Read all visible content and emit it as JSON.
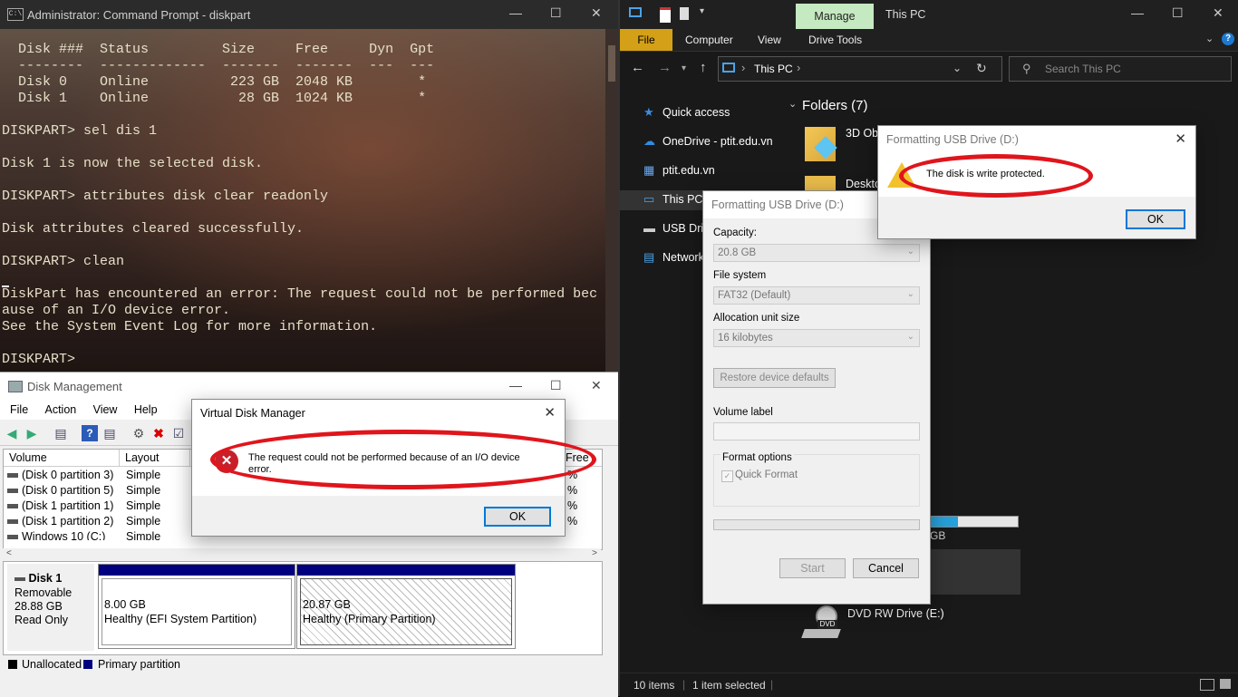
{
  "cmd": {
    "title": "Administrator: Command Prompt - diskpart",
    "lines": [
      "  Disk ###  Status         Size     Free     Dyn  Gpt",
      "  --------  -------------  -------  -------  ---  ---",
      "  Disk 0    Online          223 GB  2048 KB        *",
      "  Disk 1    Online           28 GB  1024 KB        *",
      "",
      "DISKPART> sel dis 1",
      "",
      "Disk 1 is now the selected disk.",
      "",
      "DISKPART> attributes disk clear readonly",
      "",
      "Disk attributes cleared successfully.",
      "",
      "DISKPART> clean",
      "",
      "DiskPart has encountered an error: The request could not be performed bec",
      "ause of an I/O device error.",
      "See the System Event Log for more information.",
      "",
      "DISKPART>"
    ]
  },
  "disk_management": {
    "title": "Disk Management",
    "menu": [
      "File",
      "Action",
      "View",
      "Help"
    ],
    "columns": [
      "Volume",
      "Layout",
      "Free"
    ],
    "volumes": [
      {
        "name": "(Disk 0 partition 3)",
        "layout": "Simple",
        "pct": "%"
      },
      {
        "name": "(Disk 0 partition 5)",
        "layout": "Simple",
        "pct": "%"
      },
      {
        "name": "(Disk 1 partition 1)",
        "layout": "Simple",
        "pct": "%"
      },
      {
        "name": "(Disk 1 partition 2)",
        "layout": "Simple",
        "pct": "%"
      },
      {
        "name": "Windows 10 (C:)",
        "layout": "Simple",
        "pct": "%"
      }
    ],
    "disk": {
      "name": "Disk 1",
      "type": "Removable",
      "size": "28.88 GB",
      "state": "Read Only"
    },
    "partitions": [
      {
        "size": "8.00 GB",
        "status": "Healthy (EFI System Partition)"
      },
      {
        "size": "20.87 GB",
        "status": "Healthy (Primary Partition)"
      }
    ],
    "legend": [
      {
        "label": "Unallocated",
        "color": "#000000"
      },
      {
        "label": "Primary partition",
        "color": "#00007f"
      }
    ]
  },
  "vdm_dialog": {
    "title": "Virtual Disk Manager",
    "message_line1": "The request could not be performed because of an I/O device",
    "message_line2": "error.",
    "ok": "OK"
  },
  "explorer": {
    "title": "This PC",
    "manage_tab": "Manage",
    "ribbon_tabs": [
      "File",
      "Computer",
      "View",
      "Drive Tools"
    ],
    "address": "This PC",
    "search_placeholder": "Search This PC",
    "nav": [
      {
        "label": "Quick access",
        "icon": "star-icon"
      },
      {
        "label": "OneDrive - ptit.edu.vn",
        "icon": "cloud-icon"
      },
      {
        "label": "ptit.edu.vn",
        "icon": "building-icon"
      },
      {
        "label": "This PC",
        "icon": "computer-icon"
      },
      {
        "label": "USB Drive",
        "icon": "usb-drive-icon"
      },
      {
        "label": "Network",
        "icon": "network-icon"
      }
    ],
    "folders_header": "Folders (7)",
    "folders": [
      "3D Obj",
      "Desktop"
    ],
    "drive_fragment": "GB",
    "dvd_drive": "DVD RW Drive (E:)",
    "dvd_badge": "DVD",
    "status": {
      "items": "10 items",
      "selected": "1 item selected"
    }
  },
  "format_dialog": {
    "title": "Formatting USB Drive (D:)",
    "capacity_label": "Capacity:",
    "capacity_value": "20.8 GB",
    "fs_label": "File system",
    "fs_value": "FAT32 (Default)",
    "alloc_label": "Allocation unit size",
    "alloc_value": "16 kilobytes",
    "restore": "Restore device defaults",
    "volume_label": "Volume label",
    "format_options": "Format options",
    "quick_format": "Quick Format",
    "start": "Start",
    "cancel": "Cancel"
  },
  "write_protect_dialog": {
    "title": "Formatting USB Drive (D:)",
    "message": "The disk is write protected.",
    "ok": "OK"
  },
  "colors": {
    "annotation_red": "#e0151c",
    "file_tab": "#d4a017",
    "manage_tab": "#c5e9c0"
  }
}
